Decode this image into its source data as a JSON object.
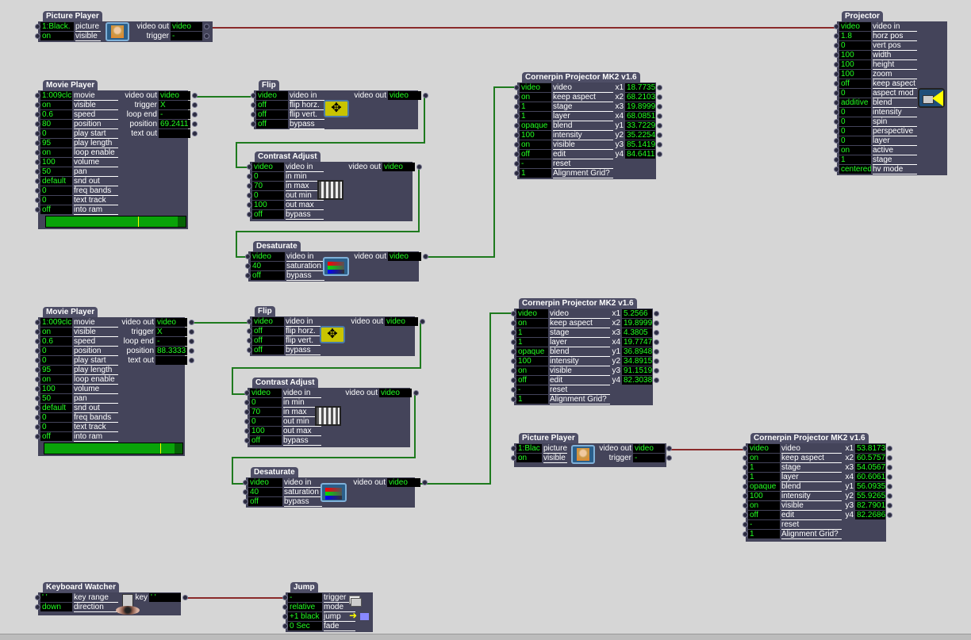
{
  "wire_colors": {
    "video": "#1e7a1e",
    "trigger": "#8a2a2a"
  },
  "nodes": [
    {
      "id": "pp1",
      "title": "Picture Player",
      "icon": "picture-thumbnail",
      "inputs": [
        {
          "value": "1:Black.",
          "label": "picture"
        },
        {
          "value": "on",
          "label": "visible"
        }
      ],
      "outputs": [
        {
          "label": "video out",
          "value": "video"
        },
        {
          "label": "trigger",
          "value": "-"
        }
      ]
    },
    {
      "id": "mp1",
      "title": "Movie Player",
      "icon": "movie-progress",
      "progress": 0.69,
      "inputs": [
        {
          "value": "1:009clc",
          "label": "movie"
        },
        {
          "value": "on",
          "label": "visible"
        },
        {
          "value": "0.6",
          "label": "speed"
        },
        {
          "value": "80",
          "label": "position"
        },
        {
          "value": "0",
          "label": "play start"
        },
        {
          "value": "95",
          "label": "play length"
        },
        {
          "value": "on",
          "label": "loop enable"
        },
        {
          "value": "100",
          "label": "volume"
        },
        {
          "value": "50",
          "label": "pan"
        },
        {
          "value": "default",
          "label": "snd out"
        },
        {
          "value": "0",
          "label": "freq bands"
        },
        {
          "value": "0",
          "label": "text track"
        },
        {
          "value": "off",
          "label": "into ram"
        }
      ],
      "outputs": [
        {
          "label": "video out",
          "value": "video"
        },
        {
          "label": "trigger",
          "value": "X"
        },
        {
          "label": "loop end",
          "value": "-"
        },
        {
          "label": "position",
          "value": "69.2411"
        },
        {
          "label": "text out",
          "value": ""
        }
      ]
    },
    {
      "id": "flip1",
      "title": "Flip",
      "icon": "flip-arrows",
      "inputs": [
        {
          "value": "video",
          "label": "video in"
        },
        {
          "value": "off",
          "label": "flip horz."
        },
        {
          "value": "off",
          "label": "flip vert."
        },
        {
          "value": "off",
          "label": "bypass"
        }
      ],
      "outputs": [
        {
          "label": "video out",
          "value": "video"
        }
      ]
    },
    {
      "id": "ca1",
      "title": "Contrast Adjust",
      "icon": "contrast-stripes",
      "inputs": [
        {
          "value": "video",
          "label": "video in"
        },
        {
          "value": "0",
          "label": "in min"
        },
        {
          "value": "70",
          "label": "in max"
        },
        {
          "value": "0",
          "label": "out min"
        },
        {
          "value": "100",
          "label": "out max"
        },
        {
          "value": "off",
          "label": "bypass"
        }
      ],
      "outputs": [
        {
          "label": "video out",
          "value": "video"
        }
      ]
    },
    {
      "id": "ds1",
      "title": "Desaturate",
      "icon": "rgb-bars",
      "inputs": [
        {
          "value": "video",
          "label": "video in"
        },
        {
          "value": "40",
          "label": "saturation"
        },
        {
          "value": "off",
          "label": "bypass"
        }
      ],
      "outputs": [
        {
          "label": "video out",
          "value": "video"
        }
      ]
    },
    {
      "id": "cp1",
      "title": "Cornerpin Projector MK2 v1.6",
      "icon": "",
      "inputs": [
        {
          "value": "video",
          "label": "video"
        },
        {
          "value": "on",
          "label": "keep aspect"
        },
        {
          "value": "1",
          "label": "stage"
        },
        {
          "value": "1",
          "label": "layer"
        },
        {
          "value": "opaque",
          "label": "blend"
        },
        {
          "value": "100",
          "label": "intensity"
        },
        {
          "value": "on",
          "label": "visible"
        },
        {
          "value": "off",
          "label": "edit"
        },
        {
          "value": "-",
          "label": "reset"
        },
        {
          "value": "1",
          "label": "Alignment Grid?"
        }
      ],
      "outputs": [
        {
          "label": "x1",
          "value": "18.7735"
        },
        {
          "label": "x2",
          "value": "68.2103"
        },
        {
          "label": "x3",
          "value": "19.8999"
        },
        {
          "label": "x4",
          "value": "68.0851"
        },
        {
          "label": "y1",
          "value": "33.7229"
        },
        {
          "label": "y2",
          "value": "35.2254"
        },
        {
          "label": "y3",
          "value": "85.1419"
        },
        {
          "label": "y4",
          "value": "84.6411"
        }
      ]
    },
    {
      "id": "proj",
      "title": "Projector",
      "icon": "projector-lamp",
      "inputs": [
        {
          "value": "video",
          "label": "video in"
        },
        {
          "value": "1.8",
          "label": "horz pos"
        },
        {
          "value": "0",
          "label": "vert pos"
        },
        {
          "value": "100",
          "label": "width"
        },
        {
          "value": "100",
          "label": "height"
        },
        {
          "value": "100",
          "label": "zoom"
        },
        {
          "value": "off",
          "label": "keep aspect"
        },
        {
          "value": "0",
          "label": "aspect mod"
        },
        {
          "value": "additive",
          "label": "blend"
        },
        {
          "value": "0",
          "label": "intensity"
        },
        {
          "value": "0",
          "label": "spin"
        },
        {
          "value": "0",
          "label": "perspective"
        },
        {
          "value": "0",
          "label": "layer"
        },
        {
          "value": "on",
          "label": "active"
        },
        {
          "value": "1",
          "label": "stage"
        },
        {
          "value": "centered",
          "label": "hv mode"
        }
      ],
      "outputs": []
    },
    {
      "id": "mp2",
      "title": "Movie Player",
      "icon": "movie-progress",
      "progress": 0.88,
      "inputs": [
        {
          "value": "1:009clc",
          "label": "movie"
        },
        {
          "value": "on",
          "label": "visible"
        },
        {
          "value": "0.6",
          "label": "speed"
        },
        {
          "value": "0",
          "label": "position"
        },
        {
          "value": "0",
          "label": "play start"
        },
        {
          "value": "95",
          "label": "play length"
        },
        {
          "value": "on",
          "label": "loop enable"
        },
        {
          "value": "100",
          "label": "volume"
        },
        {
          "value": "50",
          "label": "pan"
        },
        {
          "value": "default",
          "label": "snd out"
        },
        {
          "value": "0",
          "label": "freq bands"
        },
        {
          "value": "0",
          "label": "text track"
        },
        {
          "value": "off",
          "label": "into ram"
        }
      ],
      "outputs": [
        {
          "label": "video out",
          "value": "video"
        },
        {
          "label": "trigger",
          "value": "X"
        },
        {
          "label": "loop end",
          "value": "-"
        },
        {
          "label": "position",
          "value": "88.3333"
        },
        {
          "label": "text out",
          "value": ""
        }
      ]
    },
    {
      "id": "flip2",
      "title": "Flip",
      "icon": "flip-arrows",
      "inputs": [
        {
          "value": "video",
          "label": "video in"
        },
        {
          "value": "off",
          "label": "flip horz."
        },
        {
          "value": "off",
          "label": "flip vert."
        },
        {
          "value": "off",
          "label": "bypass"
        }
      ],
      "outputs": [
        {
          "label": "video out",
          "value": "video"
        }
      ]
    },
    {
      "id": "ca2",
      "title": "Contrast Adjust",
      "icon": "contrast-stripes",
      "inputs": [
        {
          "value": "video",
          "label": "video in"
        },
        {
          "value": "0",
          "label": "in min"
        },
        {
          "value": "70",
          "label": "in max"
        },
        {
          "value": "0",
          "label": "out min"
        },
        {
          "value": "100",
          "label": "out max"
        },
        {
          "value": "off",
          "label": "bypass"
        }
      ],
      "outputs": [
        {
          "label": "video out",
          "value": "video"
        }
      ]
    },
    {
      "id": "ds2",
      "title": "Desaturate",
      "icon": "rgb-bars",
      "inputs": [
        {
          "value": "video",
          "label": "video in"
        },
        {
          "value": "40",
          "label": "saturation"
        },
        {
          "value": "off",
          "label": "bypass"
        }
      ],
      "outputs": [
        {
          "label": "video out",
          "value": "video"
        }
      ]
    },
    {
      "id": "cp2",
      "title": "Cornerpin Projector MK2 v1.6",
      "icon": "",
      "inputs": [
        {
          "value": "video",
          "label": "video"
        },
        {
          "value": "on",
          "label": "keep aspect"
        },
        {
          "value": "1",
          "label": "stage"
        },
        {
          "value": "1",
          "label": "layer"
        },
        {
          "value": "opaque",
          "label": "blend"
        },
        {
          "value": "100",
          "label": "intensity"
        },
        {
          "value": "on",
          "label": "visible"
        },
        {
          "value": "off",
          "label": "edit"
        },
        {
          "value": "-",
          "label": "reset"
        },
        {
          "value": "1",
          "label": "Alignment Grid?"
        }
      ],
      "outputs": [
        {
          "label": "x1",
          "value": "5.2566"
        },
        {
          "label": "x2",
          "value": "19.8999"
        },
        {
          "label": "x3",
          "value": "4.3805"
        },
        {
          "label": "x4",
          "value": "19.7747"
        },
        {
          "label": "y1",
          "value": "36.8948"
        },
        {
          "label": "y2",
          "value": "34.8915"
        },
        {
          "label": "y3",
          "value": "91.1519"
        },
        {
          "label": "y4",
          "value": "82.3038"
        }
      ]
    },
    {
      "id": "pp2",
      "title": "Picture Player",
      "icon": "picture-thumbnail",
      "inputs": [
        {
          "value": "1:Blac",
          "label": "picture"
        },
        {
          "value": "on",
          "label": "visible"
        }
      ],
      "outputs": [
        {
          "label": "video out",
          "value": "video"
        },
        {
          "label": "trigger",
          "value": "-"
        }
      ]
    },
    {
      "id": "cp3",
      "title": "Cornerpin Projector MK2 v1.6",
      "icon": "",
      "inputs": [
        {
          "value": "video",
          "label": "video"
        },
        {
          "value": "on",
          "label": "keep aspect"
        },
        {
          "value": "1",
          "label": "stage"
        },
        {
          "value": "1",
          "label": "layer"
        },
        {
          "value": "opaque",
          "label": "blend"
        },
        {
          "value": "100",
          "label": "intensity"
        },
        {
          "value": "on",
          "label": "visible"
        },
        {
          "value": "off",
          "label": "edit"
        },
        {
          "value": "-",
          "label": "reset"
        },
        {
          "value": "1",
          "label": "Alignment Grid?"
        }
      ],
      "outputs": [
        {
          "label": "x1",
          "value": "53.8173"
        },
        {
          "label": "x2",
          "value": "60.5757"
        },
        {
          "label": "x3",
          "value": "54.0567"
        },
        {
          "label": "x4",
          "value": "60.6061"
        },
        {
          "label": "y1",
          "value": "56.0935"
        },
        {
          "label": "y2",
          "value": "55.9265"
        },
        {
          "label": "y3",
          "value": "82.7901"
        },
        {
          "label": "y4",
          "value": "82.2686"
        }
      ]
    },
    {
      "id": "kw",
      "title": "Keyboard Watcher",
      "icon": "eye-key",
      "inputs": [
        {
          "value": "' '",
          "label": "key range"
        },
        {
          "value": "down",
          "label": "direction"
        }
      ],
      "outputs": [
        {
          "label": "key",
          "value": "' '"
        }
      ]
    },
    {
      "id": "jump",
      "title": "Jump",
      "icon": "jump-arrow",
      "inputs": [
        {
          "value": "-",
          "label": "trigger"
        },
        {
          "value": "relative",
          "label": "mode"
        },
        {
          "value": "+1 black",
          "label": "jump"
        },
        {
          "value": "0 Sec",
          "label": "fade"
        }
      ],
      "outputs": []
    }
  ]
}
